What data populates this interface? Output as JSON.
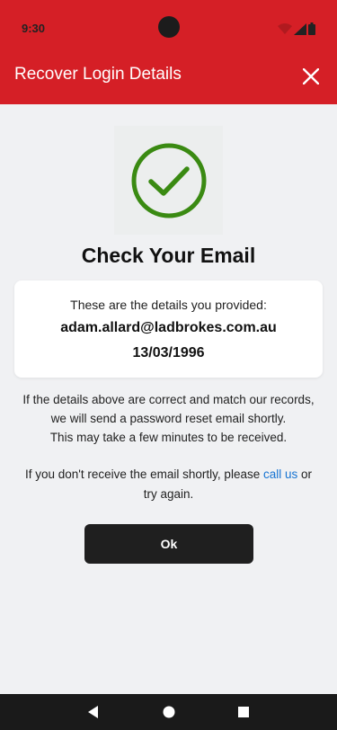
{
  "status_bar": {
    "time": "9:30",
    "icons": [
      "wifi-icon",
      "signal-icon",
      "battery-icon"
    ]
  },
  "app_bar": {
    "title": "Recover Login Details",
    "close_icon": "close-icon",
    "background": "#d51f26"
  },
  "main": {
    "success_icon": "check-circle-icon",
    "success_color": "#3a8a12",
    "heading": "Check Your Email",
    "card": {
      "intro": "These are the details you provided:",
      "email": "adam.allard@ladbrokes.com.au",
      "dob": "13/03/1996"
    },
    "info_lines": [
      "If the details above are correct and match our records,",
      "we will send a password reset email shortly.",
      "This may take a few minutes to be received."
    ],
    "help": {
      "before": "If you don't receive the email shortly, please ",
      "link": "call us",
      "after": " or",
      "line2": "try again."
    },
    "ok_label": "Ok"
  },
  "nav_bar": {
    "icons": [
      "back-icon",
      "home-icon",
      "recents-icon"
    ]
  },
  "colors": {
    "accent": "#d51f26",
    "link": "#1573d2",
    "button": "#1f1f1f"
  }
}
